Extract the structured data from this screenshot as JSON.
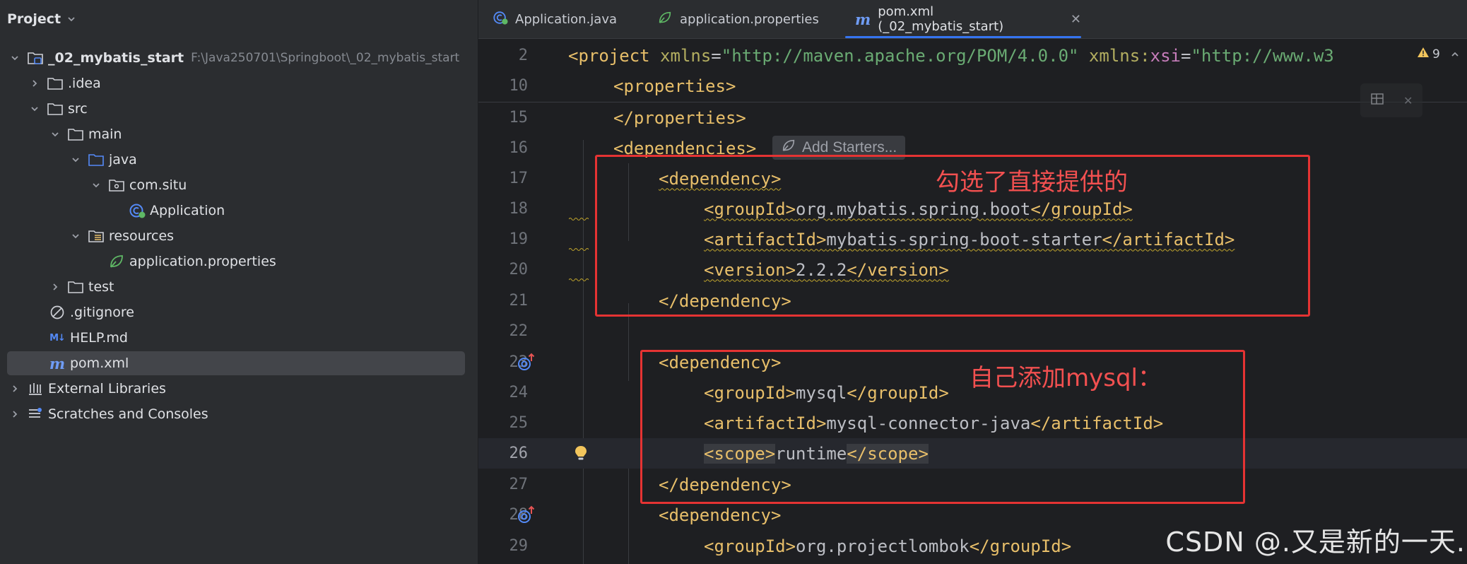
{
  "project": {
    "header": "Project",
    "tree": [
      {
        "label": "_02_mybatis_start",
        "path": "F:\\Java250701\\Springboot\\_02_mybatis_start",
        "icon": "module-folder-icon"
      },
      {
        "label": ".idea",
        "icon": "folder-icon"
      },
      {
        "label": "src",
        "icon": "folder-icon"
      },
      {
        "label": "main",
        "icon": "folder-icon"
      },
      {
        "label": "java",
        "icon": "source-folder-icon"
      },
      {
        "label": "com.situ",
        "icon": "package-icon"
      },
      {
        "label": "Application",
        "icon": "spring-boot-class-icon"
      },
      {
        "label": "resources",
        "icon": "resources-folder-icon"
      },
      {
        "label": "application.properties",
        "icon": "spring-properties-icon"
      },
      {
        "label": "test",
        "icon": "folder-icon"
      },
      {
        "label": ".gitignore",
        "icon": "gitignore-icon"
      },
      {
        "label": "HELP.md",
        "icon": "markdown-icon",
        "glyph": "M↓"
      },
      {
        "label": "pom.xml",
        "icon": "maven-icon",
        "glyph": "m"
      },
      {
        "label": "External Libraries",
        "icon": "library-icon"
      },
      {
        "label": "Scratches and Consoles",
        "icon": "scratches-icon"
      }
    ]
  },
  "tabs": [
    {
      "label": "Application.java",
      "icon": "spring-boot-class-icon"
    },
    {
      "label": "application.properties",
      "icon": "spring-properties-icon"
    },
    {
      "label": "pom.xml (_02_mybatis_start)",
      "icon": "maven-icon",
      "glyph": "m"
    }
  ],
  "editor": {
    "lines": [
      "2",
      "10",
      "15",
      "16",
      "17",
      "18",
      "19",
      "20",
      "21",
      "22",
      "23",
      "24",
      "25",
      "26",
      "27",
      "28",
      "29"
    ],
    "code": {
      "project_open": "<project",
      "xmlns_attr": " xmlns",
      "eq": "=",
      "xmlns_val": "\"http://maven.apache.org/POM/4.0.0\"",
      "xmlns_xsi_prefix": " xmlns:",
      "xsi": "xsi",
      "xsi_val": "\"http://www.w3",
      "properties_open": "<properties>",
      "properties_close": "</properties>",
      "dependencies_open": "<dependencies>",
      "dependency_open": "<dependency>",
      "dependency_close": "</dependency>",
      "groupId_open": "<groupId>",
      "groupId_close": "</groupId>",
      "artifactId_open": "<artifactId>",
      "artifactId_close": "</artifactId>",
      "version_open": "<version>",
      "version_close": "</version>",
      "scope_open": "<scope>",
      "scope_close": "</scope>",
      "g1": "org.mybatis.spring.boot",
      "a1": "mybatis-spring-boot-starter",
      "v1": "2.2.2",
      "g2": "mysql",
      "a2": "mysql-connector-java",
      "s2": "runtime",
      "g3": "org.projectlombok"
    },
    "add_starters": "Add Starters...",
    "warning_count": "9"
  },
  "annotations": {
    "box1_text": "勾选了直接提供的",
    "box2_text": "自己添加mysql："
  },
  "watermark": "CSDN @.又是新的一天.",
  "colors": {
    "annotation": "#e53333",
    "accent": "#3574f0",
    "tag": "#e8bf6a",
    "string": "#6aab73"
  }
}
